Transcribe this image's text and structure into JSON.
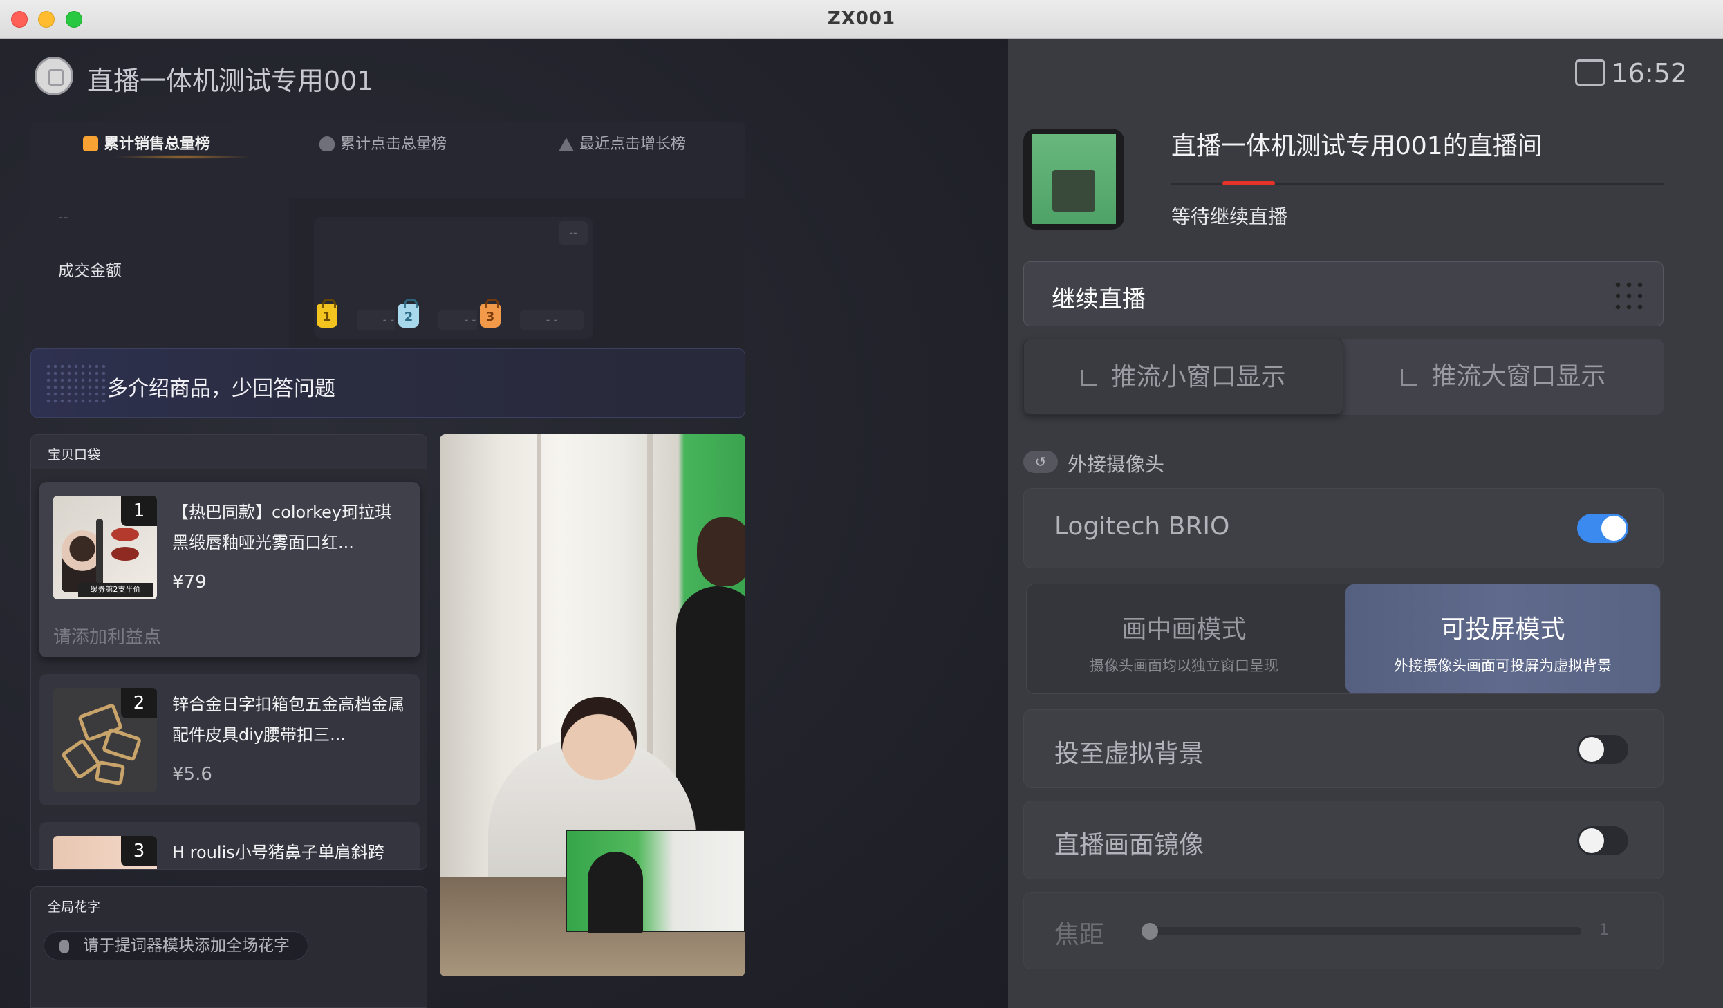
{
  "window": {
    "title": "ZX001"
  },
  "left": {
    "room_title": "直播一体机测试专用001",
    "rank": {
      "tabs": [
        "累计销售总量榜",
        "累计点击总量榜",
        "最近点击增长榜"
      ],
      "active_tab": 0,
      "gmv_value": "--",
      "gmv_label": "成交金额",
      "slots": [
        {
          "rank": "1",
          "badge": "--",
          "value": "- -"
        },
        {
          "rank": "2",
          "badge": "--",
          "value": "- -"
        },
        {
          "rank": "3",
          "badge": "--",
          "value": "- -"
        }
      ]
    },
    "tip": "多介绍商品，少回答问题",
    "bag": {
      "title": "宝贝口袋",
      "items": [
        {
          "index": "1",
          "name": "【热巴同款】colorkey珂拉琪黑缎唇釉哑光雾面口红...",
          "price": "¥79",
          "note": "请添加利益点",
          "thumb_tag": "缓券第2支半价"
        },
        {
          "index": "2",
          "name": "锌合金日字扣箱包五金高档金属配件皮具diy腰带扣三...",
          "price": "¥5.6"
        },
        {
          "index": "3",
          "name": "H roulis小号猪鼻子单肩斜跨"
        }
      ]
    },
    "flower": {
      "title": "全局花字",
      "placeholder": "请于提词器模块添加全场花字"
    }
  },
  "right": {
    "time": "16:52",
    "live_title": "直播一体机测试专用001的直播间",
    "live_status": "等待继续直播",
    "continue_label": "继续直播",
    "stream_buttons": [
      "推流小窗口显示",
      "推流大窗口显示"
    ],
    "stream_active": 0,
    "external_camera_label": "外接摄像头",
    "camera": {
      "name": "Logitech BRIO",
      "enabled": true
    },
    "modes": [
      {
        "title": "画中画模式",
        "subtitle": "摄像头画面均以独立窗口呈现"
      },
      {
        "title": "可投屏模式",
        "subtitle": "外接摄像头画面可投屏为虚拟背景"
      }
    ],
    "mode_active": 1,
    "virtual_bg": {
      "label": "投至虚拟背景",
      "enabled": false
    },
    "mirror": {
      "label": "直播画面镜像",
      "enabled": false
    },
    "focus": {
      "label": "焦距",
      "value": "1"
    }
  },
  "colors": {
    "accent_blue": "#3b8af0",
    "live_red": "#e4332a",
    "rank_gold": "#f7a233"
  }
}
